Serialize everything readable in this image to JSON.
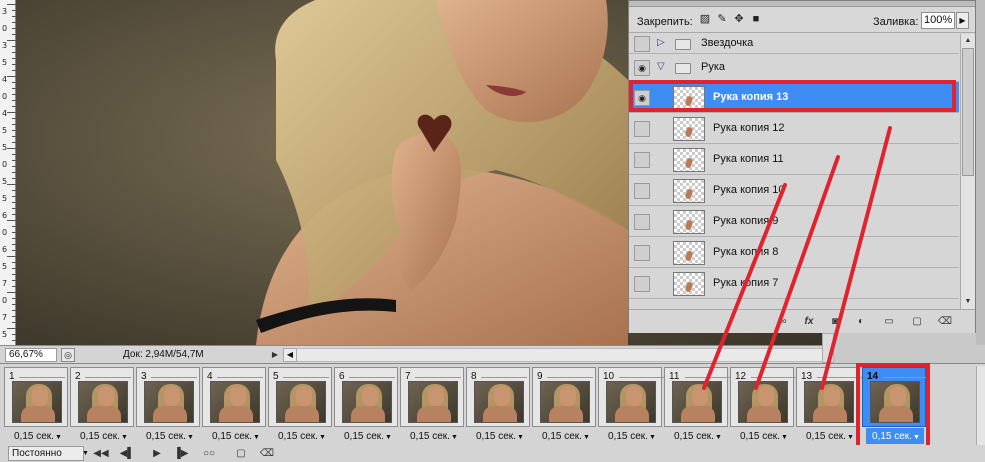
{
  "canvas": {
    "ruler_labels": [
      "3",
      "0",
      "3",
      "5",
      "4",
      "0",
      "4",
      "5",
      "5",
      "0",
      "5",
      "5",
      "6",
      "0",
      "6",
      "5",
      "7",
      "0",
      "7",
      "5"
    ]
  },
  "statusbar": {
    "zoom": "66,67%",
    "doc_info": "Док: 2,94M/54,7M"
  },
  "layers_panel": {
    "lock_label": "Закрепить:",
    "fill_label": "Заливка:",
    "fill_value": "100%",
    "layers": [
      {
        "name": "Звездочка",
        "type": "group",
        "expanded": false,
        "visible": false
      },
      {
        "name": "Рука",
        "type": "group",
        "expanded": true,
        "visible": true
      },
      {
        "name": "Рука копия 13",
        "type": "layer",
        "visible": true,
        "selected": true
      },
      {
        "name": "Рука копия 12",
        "type": "layer",
        "visible": false
      },
      {
        "name": "Рука копия 11",
        "type": "layer",
        "visible": false
      },
      {
        "name": "Рука копия 10",
        "type": "layer",
        "visible": false
      },
      {
        "name": "Рука копия 9",
        "type": "layer",
        "visible": false
      },
      {
        "name": "Рука копия 8",
        "type": "layer",
        "visible": false
      },
      {
        "name": "Рука копия 7",
        "type": "layer",
        "visible": false
      }
    ],
    "footer_icons": [
      "link-icon",
      "fx-icon",
      "mask-icon",
      "adjustment-icon",
      "group-icon",
      "new-layer-icon",
      "trash-icon"
    ]
  },
  "animation": {
    "frames": [
      {
        "num": "1",
        "delay": "0,15 сек."
      },
      {
        "num": "2",
        "delay": "0,15 сек."
      },
      {
        "num": "3",
        "delay": "0,15 сек."
      },
      {
        "num": "4",
        "delay": "0,15 сек."
      },
      {
        "num": "5",
        "delay": "0,15 сек."
      },
      {
        "num": "6",
        "delay": "0,15 сек."
      },
      {
        "num": "7",
        "delay": "0,15 сек."
      },
      {
        "num": "8",
        "delay": "0,15 сек."
      },
      {
        "num": "9",
        "delay": "0,15 сек."
      },
      {
        "num": "10",
        "delay": "0,15 сек."
      },
      {
        "num": "11",
        "delay": "0,15 сек."
      },
      {
        "num": "12",
        "delay": "0,15 сек."
      },
      {
        "num": "13",
        "delay": "0,15 сек."
      },
      {
        "num": "14",
        "delay": "0,15 сек.",
        "selected": true
      }
    ],
    "loop_value": "Постоянно"
  },
  "colors": {
    "selection": "#3d8df4",
    "highlight_red": "#e0242f"
  }
}
